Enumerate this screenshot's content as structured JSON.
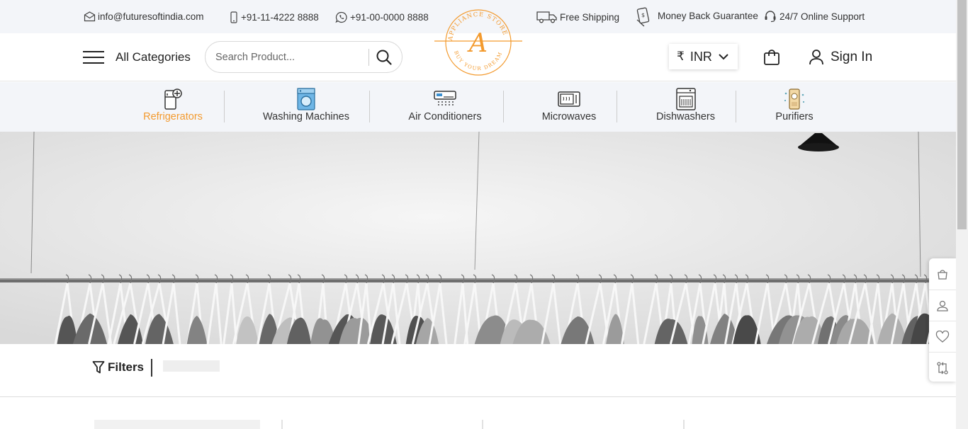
{
  "topbar": {
    "email": "info@futuresoftindia.com",
    "phone": "+91-11-4222 8888",
    "whatsapp": "+91-00-0000 8888",
    "shipping": "Free Shipping",
    "guarantee": "Money Back Guarantee",
    "support": "24/7 Online Support"
  },
  "header": {
    "all_categories": "All Categories",
    "search_placeholder": "Search Product...",
    "currency_symbol": "₹",
    "currency": "INR",
    "sign_in": "Sign In",
    "logo": {
      "top_text": "APPLIANCE STORE",
      "bottom_text": "BUY YOUR DREAM",
      "letter": "A"
    }
  },
  "categories": [
    {
      "label": "Refrigerators",
      "active": true,
      "icon": "refrigerator-icon"
    },
    {
      "label": "Washing Machines",
      "active": false,
      "icon": "washing-machine-icon"
    },
    {
      "label": "Air Conditioners",
      "active": false,
      "icon": "air-conditioner-icon"
    },
    {
      "label": "Microwaves",
      "active": false,
      "icon": "microwave-icon"
    },
    {
      "label": "Dishwashers",
      "active": false,
      "icon": "dishwasher-icon"
    },
    {
      "label": "Purifiers",
      "active": false,
      "icon": "purifier-icon"
    }
  ],
  "filters": {
    "label": "Filters"
  },
  "side_panel": [
    "bag-icon",
    "user-icon",
    "heart-icon",
    "compare-icon"
  ],
  "colors": {
    "accent": "#f39a2e",
    "bar_bg": "#f3f5f9"
  }
}
